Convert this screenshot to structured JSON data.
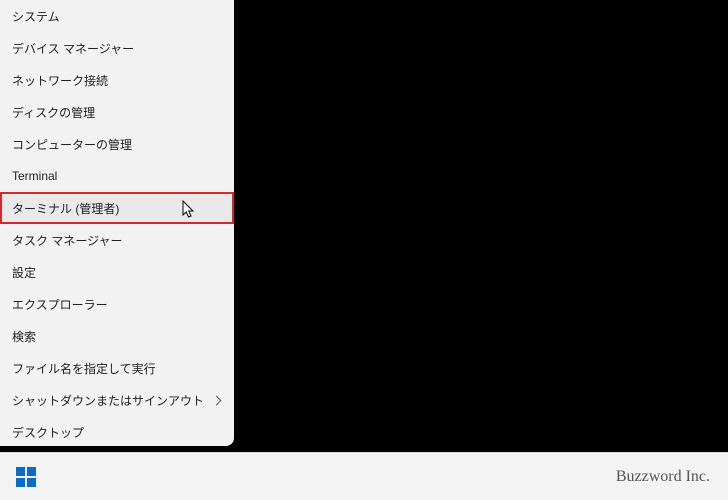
{
  "menu": {
    "items": [
      {
        "label": "システム",
        "submenu": false
      },
      {
        "label": "デバイス マネージャー",
        "submenu": false
      },
      {
        "label": "ネットワーク接続",
        "submenu": false
      },
      {
        "label": "ディスクの管理",
        "submenu": false
      },
      {
        "label": "コンピューターの管理",
        "submenu": false
      },
      {
        "label": "Terminal",
        "submenu": false
      },
      {
        "label": "ターミナル (管理者)",
        "submenu": false,
        "highlighted": true
      },
      {
        "label": "タスク マネージャー",
        "submenu": false
      },
      {
        "label": "設定",
        "submenu": false
      },
      {
        "label": "エクスプローラー",
        "submenu": false
      },
      {
        "label": "検索",
        "submenu": false
      },
      {
        "label": "ファイル名を指定して実行",
        "submenu": false
      },
      {
        "label": "シャットダウンまたはサインアウト",
        "submenu": true
      },
      {
        "label": "デスクトップ",
        "submenu": false
      }
    ]
  },
  "taskbar": {
    "brand": "Buzzword Inc."
  }
}
